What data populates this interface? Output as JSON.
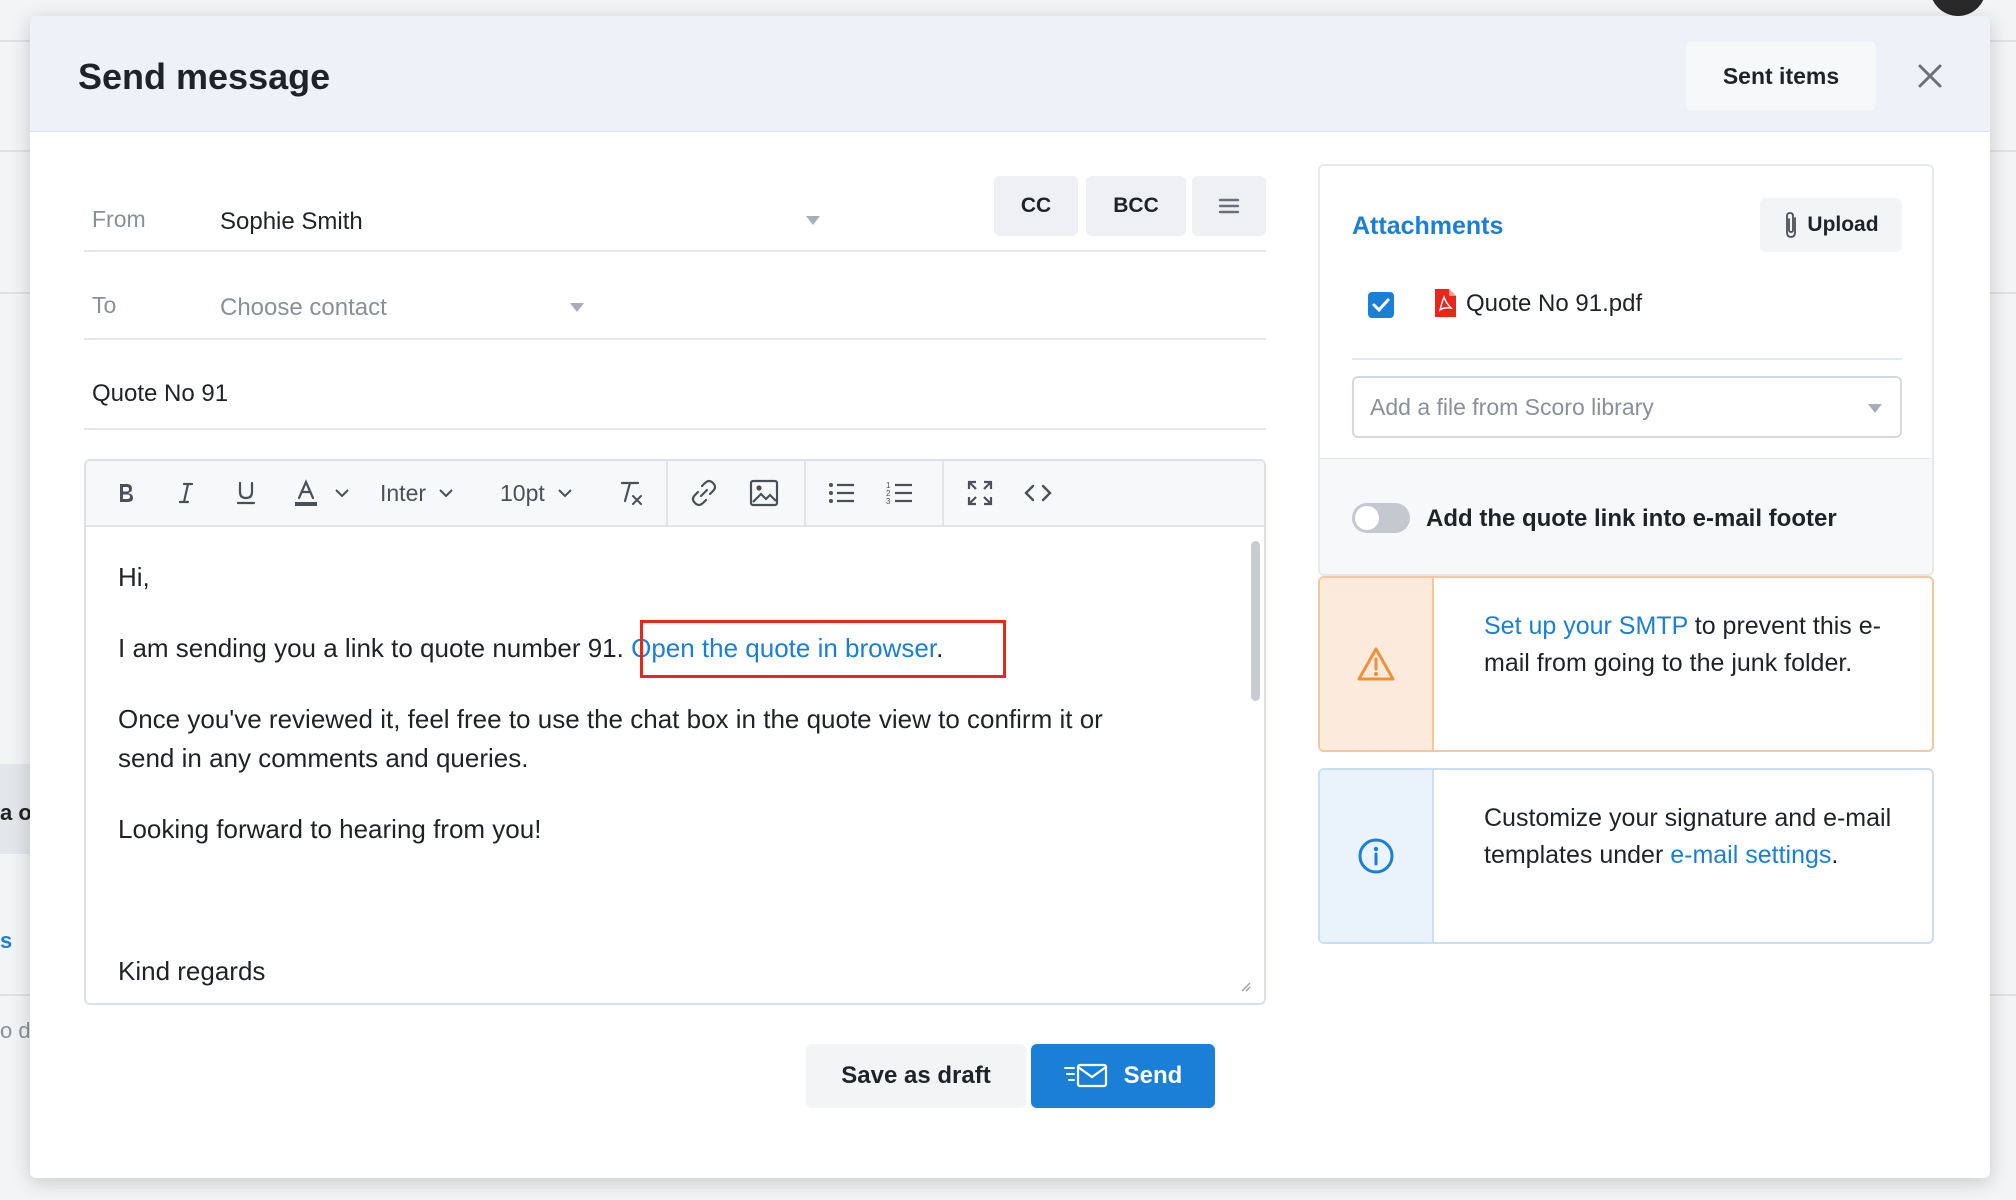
{
  "background": {
    "fragments": [
      "a o",
      "s",
      "o di"
    ]
  },
  "modal": {
    "title": "Send message",
    "sent_items_label": "Sent items"
  },
  "form": {
    "from_label": "From",
    "from_value": "Sophie Smith",
    "cc_label": "CC",
    "bcc_label": "BCC",
    "to_label": "To",
    "to_placeholder": "Choose contact",
    "subject": "Quote No 91"
  },
  "toolbar": {
    "font_name": "Inter",
    "font_size": "10pt"
  },
  "message": {
    "greeting": "Hi,",
    "line1_prefix": "I am sending you a link to quote number 91. ",
    "line1_link": "Open the quote in browser",
    "line1_suffix": ".",
    "para2_line1": "Once you've reviewed it, feel free to use the chat box in the quote view to confirm it or",
    "para2_line2": "send in any comments and queries.",
    "para3": "Looking forward to hearing from you!",
    "closing": "Kind regards"
  },
  "actions": {
    "draft_label": "Save as draft",
    "send_label": "Send"
  },
  "attachments": {
    "title": "Attachments",
    "upload_label": "Upload",
    "file_name": "Quote No 91.pdf",
    "file_checked": true,
    "library_placeholder": "Add a file from Scoro library",
    "quote_link_toggle_label": "Add the quote link into e-mail footer",
    "quote_link_toggle_on": false
  },
  "smtp_notice": {
    "link": "Set up your SMTP",
    "text": " to prevent this e-mail from going to the junk folder."
  },
  "signature_notice": {
    "text": "Customize your signature and e-mail templates under ",
    "link": "e-mail settings",
    "suffix": "."
  },
  "colors": {
    "accent": "#1a7fd6",
    "warning_bg": "#fcebdc",
    "warning_border": "#f5c7a0",
    "warning_icon": "#f0913a",
    "info_bg": "#eaf3fb",
    "info_border": "#c8def2",
    "highlight": "#e8261b"
  }
}
